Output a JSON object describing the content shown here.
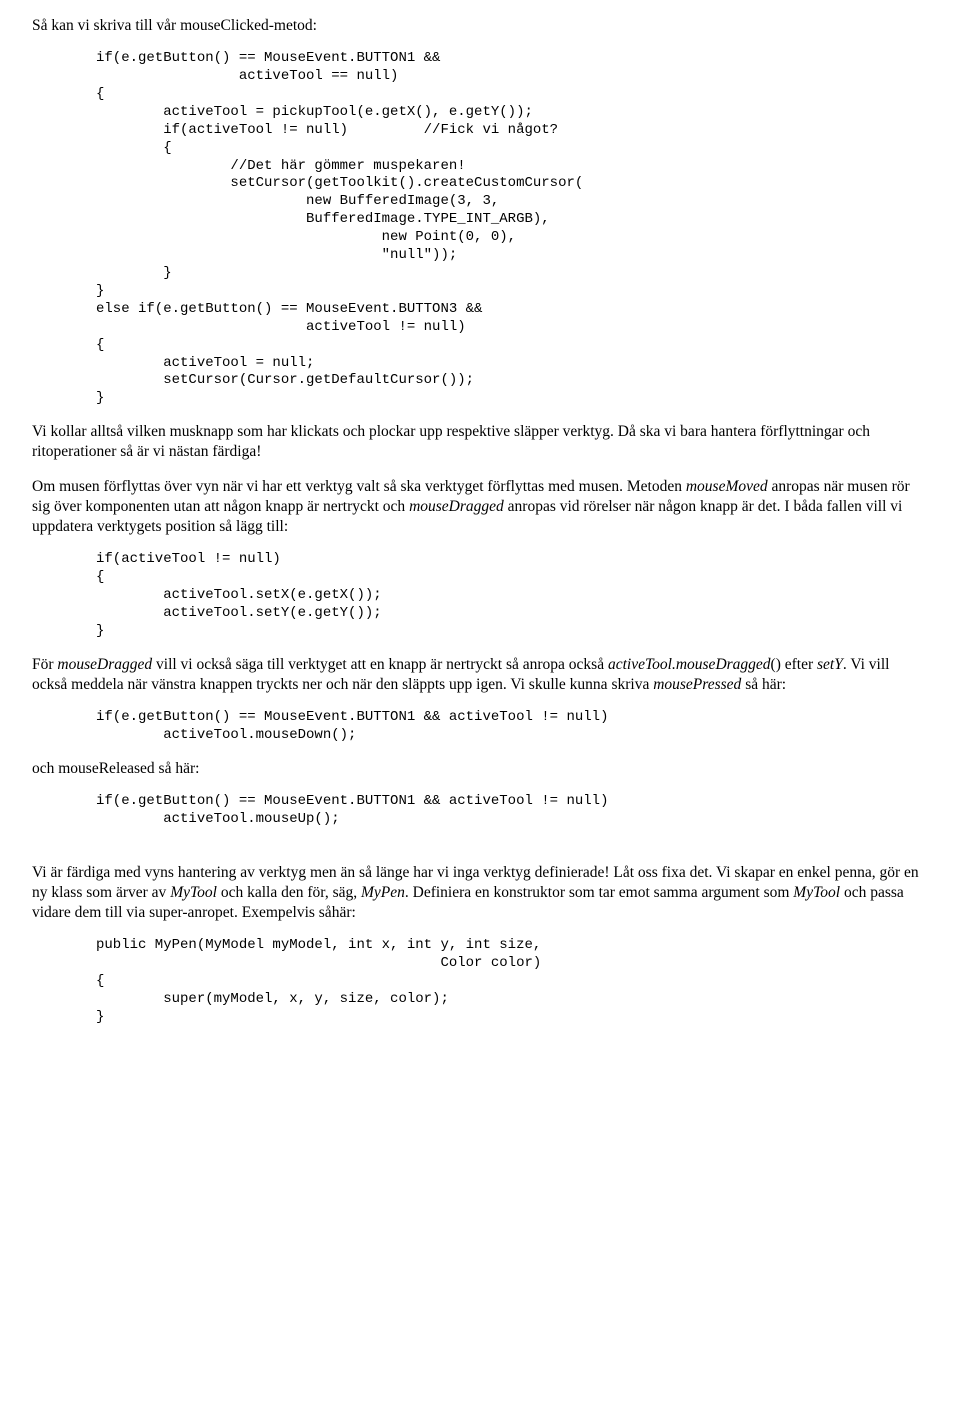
{
  "p1": "Så kan vi skriva till vår mouseClicked-metod:",
  "code1": "if(e.getButton() == MouseEvent.BUTTON1 &&\n                 activeTool == null)\n{\n        activeTool = pickupTool(e.getX(), e.getY());\n        if(activeTool != null)         //Fick vi något?\n        {\n                //Det här gömmer muspekaren!\n                setCursor(getToolkit().createCustomCursor(\n                         new BufferedImage(3, 3,\n                         BufferedImage.TYPE_INT_ARGB),\n                                  new Point(0, 0),\n                                  \"null\"));\n        }\n}\nelse if(e.getButton() == MouseEvent.BUTTON3 &&\n                         activeTool != null)\n{\n        activeTool = null;\n        setCursor(Cursor.getDefaultCursor());\n}",
  "p2": "Vi kollar alltså vilken musknapp som har klickats och plockar upp respektive släpper verktyg. Då ska vi bara hantera förflyttningar och ritoperationer så är vi nästan färdiga!",
  "p3_a": "Om musen förflyttas över vyn när vi har ett verktyg valt så ska verktyget förflyttas med musen. Metoden ",
  "p3_i1": "mouseMoved",
  "p3_b": " anropas när musen rör sig över komponenten utan att någon knapp är nertryckt och ",
  "p3_i2": "mouseDragged",
  "p3_c": " anropas vid rörelser när någon knapp är det. I båda fallen vill vi uppdatera verktygets position så lägg till:",
  "code2": "if(activeTool != null)\n{\n        activeTool.setX(e.getX());\n        activeTool.setY(e.getY());\n}",
  "p4_a": "För ",
  "p4_i1": "mouseDragged",
  "p4_b": " vill vi också säga till verktyget att en knapp är nertryckt så anropa också ",
  "p4_i2": "activeTool.mouseDragged",
  "p4_c": "() efter ",
  "p4_i3": "setY",
  "p4_d": ". Vi vill också meddela när vänstra knappen tryckts ner och när den släppts upp igen. Vi skulle kunna skriva ",
  "p4_i4": "mousePressed",
  "p4_e": " så här:",
  "code3": "if(e.getButton() == MouseEvent.BUTTON1 && activeTool != null)\n        activeTool.mouseDown();",
  "p5": "och mouseReleased så här:",
  "code4": "if(e.getButton() == MouseEvent.BUTTON1 && activeTool != null)\n        activeTool.mouseUp();",
  "p6_a": "Vi är färdiga med vyns hantering av verktyg men än så länge har vi inga verktyg definierade! Låt oss fixa det. Vi skapar en enkel penna, gör en ny klass som ärver av ",
  "p6_i1": "MyTool",
  "p6_b": " och kalla den för, säg, ",
  "p6_i2": "MyPen",
  "p6_c": ". Definiera en konstruktor som tar emot samma argument som ",
  "p6_i3": "MyTool",
  "p6_d": " och passa vidare dem till via super-anropet. Exempelvis såhär:",
  "code5": "public MyPen(MyModel myModel, int x, int y, int size,\n                                         Color color)\n{\n        super(myModel, x, y, size, color);\n}"
}
